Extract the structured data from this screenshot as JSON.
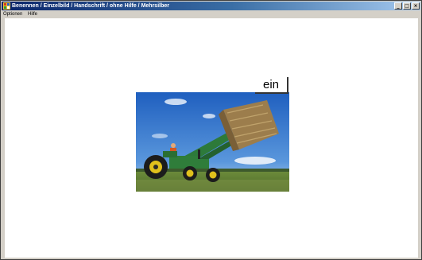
{
  "window": {
    "title": "Benennen / Einzelbild / Handschrift / ohne Hilfe / Mehrsilber"
  },
  "title_buttons": {
    "minimize": "_",
    "maximize": "□",
    "close": "×"
  },
  "menu": {
    "items": [
      {
        "label": "Optionen"
      },
      {
        "label": "Hilfe"
      }
    ]
  },
  "main": {
    "picture_icon": "tractor-hay-bale-photo",
    "word": "ein"
  },
  "colors": {
    "titlebar_start": "#0a246a",
    "titlebar_end": "#a6caf0",
    "window_face": "#d4d0c8",
    "client_background": "#ffffff"
  }
}
